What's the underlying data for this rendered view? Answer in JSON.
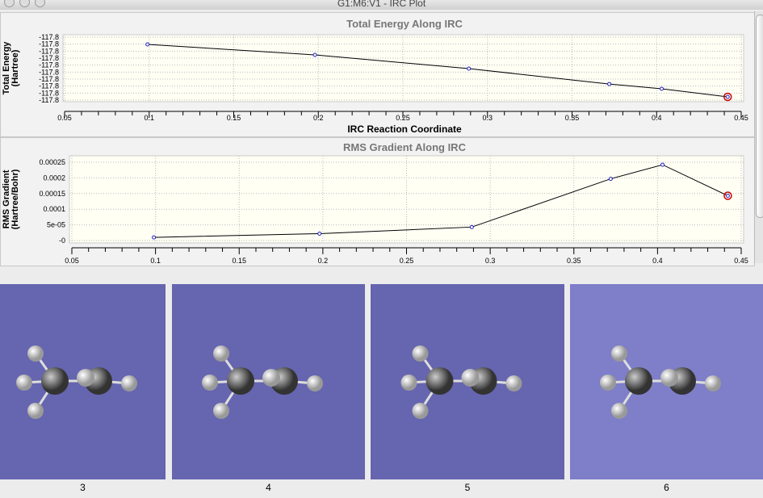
{
  "window": {
    "title": "G1:M6:V1 - IRC Plot"
  },
  "chart_data": [
    {
      "type": "line",
      "title": "Total Energy Along IRC",
      "xlabel": "IRC Reaction Coordinate",
      "ylabel": "Total Energy",
      "ylabel2": "(Hartree)",
      "x": [
        0.099,
        0.198,
        0.289,
        0.372,
        0.403,
        0.442
      ],
      "y": [
        -117.80052,
        -117.80127,
        -117.80225,
        -117.80335,
        -117.80369,
        -117.80427
      ],
      "xlim": [
        0.05,
        0.45
      ],
      "ylim": [
        -117.8045,
        -117.8
      ],
      "xticks": [
        "0.05",
        "0.1",
        "0.15",
        "0.2",
        "0.25",
        "0.3",
        "0.35",
        "0.4",
        "0.45"
      ],
      "yticks": [
        "-117.8",
        "-117.8",
        "-117.8",
        "-117.8",
        "-117.8",
        "-117.8",
        "-117.8",
        "-117.8",
        "-117.8",
        "-117.8"
      ],
      "grid": true,
      "selected_index": 5
    },
    {
      "type": "line",
      "title": "RMS Gradient Along IRC",
      "xlabel": "",
      "ylabel": "RMS Gradient",
      "ylabel2": "(Hartree/Bohr)",
      "x": [
        0.099,
        0.198,
        0.289,
        0.372,
        0.403,
        0.442
      ],
      "y": [
        1e-05,
        2.2e-05,
        4.3e-05,
        0.000197,
        0.000242,
        0.000143
      ],
      "xlim": [
        0.05,
        0.45
      ],
      "ylim": [
        0,
        0.00025
      ],
      "xticks": [
        "0.05",
        "0.1",
        "0.15",
        "0.2",
        "0.25",
        "0.3",
        "0.35",
        "0.4",
        "0.45"
      ],
      "yticks": [
        "-0",
        "5e-05",
        "0.0001",
        "0.00015",
        "0.0002",
        "0.00025"
      ],
      "grid": true,
      "selected_index": 5
    }
  ],
  "frames": [
    {
      "label": "3",
      "bg": "#6565b0"
    },
    {
      "label": "4",
      "bg": "#6565b0"
    },
    {
      "label": "5",
      "bg": "#6565b0"
    },
    {
      "label": "6",
      "bg": "#7e7ec9"
    }
  ],
  "colors": {
    "plot_bg": "#fffff4",
    "selected": "#cc0000",
    "point": "#2020c0"
  }
}
